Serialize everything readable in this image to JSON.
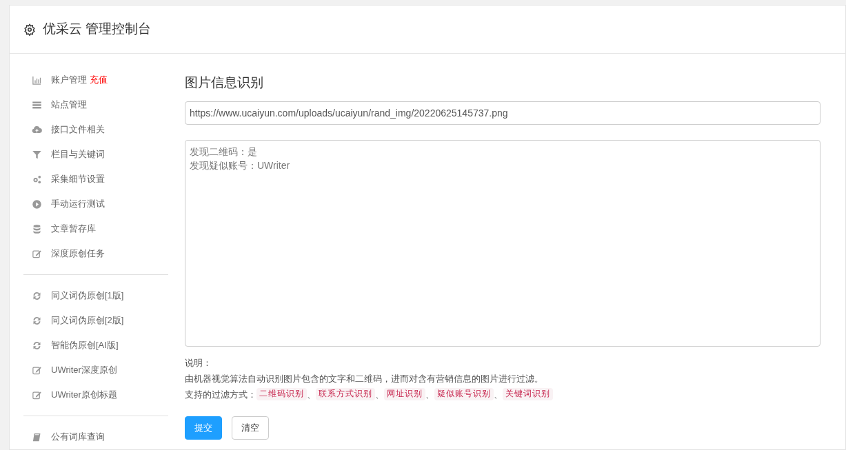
{
  "header": {
    "title": "优采云 管理控制台"
  },
  "sidebar": {
    "groups": [
      {
        "items": [
          {
            "kind": "chart",
            "label": "账户管理",
            "badge": "充值"
          },
          {
            "kind": "server",
            "label": "站点管理"
          },
          {
            "kind": "cloud",
            "label": "接口文件相关"
          },
          {
            "kind": "filter",
            "label": "栏目与关键词"
          },
          {
            "kind": "gears",
            "label": "采集细节设置"
          },
          {
            "kind": "play",
            "label": "手动运行测试"
          },
          {
            "kind": "database",
            "label": "文章暂存库"
          },
          {
            "kind": "edit",
            "label": "深度原创任务"
          }
        ]
      },
      {
        "items": [
          {
            "kind": "refresh",
            "label": "同义词伪原创[1版]"
          },
          {
            "kind": "refresh",
            "label": "同义词伪原创[2版]"
          },
          {
            "kind": "refresh",
            "label": "智能伪原创[AI版]"
          },
          {
            "kind": "edit",
            "label": "UWriter深度原创"
          },
          {
            "kind": "edit",
            "label": "UWriter原创标题"
          }
        ]
      },
      {
        "items": [
          {
            "kind": "book",
            "label": "公有词库查询"
          }
        ]
      }
    ]
  },
  "main": {
    "title": "图片信息识别",
    "url_field": {
      "value": "https://www.ucaiyun.com/uploads/ucaiyun/rand_img/20220625145737.png"
    },
    "result_box": {
      "lines": [
        "发现二维码：是",
        "发现疑似账号：UWriter"
      ]
    },
    "notes": {
      "heading": "说明：",
      "description": "由机器视觉算法自动识别图片包含的文字和二维码，进而对含有营销信息的图片进行过滤。",
      "methods_label": "支持的过滤方式：",
      "methods": [
        "二维码识别",
        "联系方式识别",
        "网址识别",
        "疑似账号识别",
        "关键词识别"
      ],
      "separator": "、"
    },
    "buttons": [
      {
        "kind": "primary",
        "label": "提交"
      },
      {
        "kind": "default",
        "label": "清空"
      }
    ]
  }
}
